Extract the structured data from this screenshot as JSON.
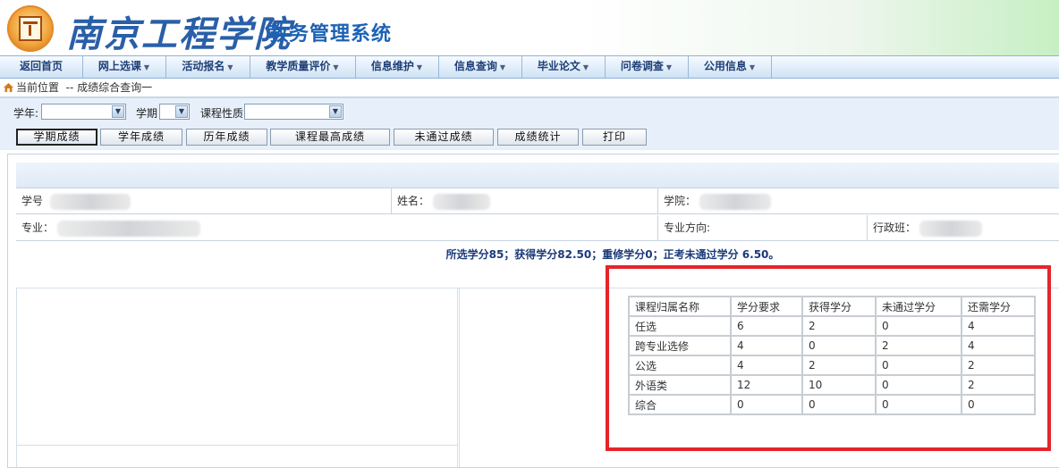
{
  "header": {
    "school_name": "南京工程学院",
    "system_name": "教务管理系统"
  },
  "nav": [
    {
      "label": "返回首页",
      "has_dropdown": false
    },
    {
      "label": "网上选课",
      "has_dropdown": true
    },
    {
      "label": "活动报名",
      "has_dropdown": true
    },
    {
      "label": "教学质量评价",
      "has_dropdown": true
    },
    {
      "label": "信息维护",
      "has_dropdown": true
    },
    {
      "label": "信息查询",
      "has_dropdown": true
    },
    {
      "label": "毕业论文",
      "has_dropdown": true
    },
    {
      "label": "问卷调查",
      "has_dropdown": true
    },
    {
      "label": "公用信息",
      "has_dropdown": true
    }
  ],
  "breadcrumb": {
    "current_label": "当前位置",
    "path": "-- 成绩综合查询一"
  },
  "filters": {
    "year_label": "学年:",
    "year_value": "",
    "term_label": "学期",
    "term_value": "",
    "course_type_label": "课程性质",
    "course_type_value": ""
  },
  "buttons": [
    {
      "label": "学期成绩",
      "active": true
    },
    {
      "label": "学年成绩",
      "active": false
    },
    {
      "label": "历年成绩",
      "active": false
    },
    {
      "label": "课程最高成绩",
      "active": false
    },
    {
      "label": "未通过成绩",
      "active": false
    },
    {
      "label": "成绩统计",
      "active": false
    },
    {
      "label": "打印",
      "active": false
    }
  ],
  "student_info": {
    "student_id_label": "学号",
    "name_label": "姓名：",
    "college_label": "学院：",
    "major_label": "专业：",
    "major_direction_label": "专业方向:",
    "admin_class_label": "行政班："
  },
  "summary": "所选学分85；获得学分82.50；重修学分0；正考未通过学分 6.50。",
  "credit_table": {
    "headers": [
      "课程归属名称",
      "学分要求",
      "获得学分",
      "未通过学分",
      "还需学分"
    ],
    "rows": [
      [
        "任选",
        "6",
        "2",
        "0",
        "4"
      ],
      [
        "跨专业选修",
        "4",
        "0",
        "2",
        "4"
      ],
      [
        "公选",
        "4",
        "2",
        "0",
        "2"
      ],
      [
        "外语类",
        "12",
        "10",
        "0",
        "2"
      ],
      [
        "综合",
        "0",
        "0",
        "0",
        "0"
      ]
    ]
  },
  "colors": {
    "highlight": "#e5242a",
    "nav_text": "#1e3f77",
    "summary_text": "#1b3a7a"
  }
}
